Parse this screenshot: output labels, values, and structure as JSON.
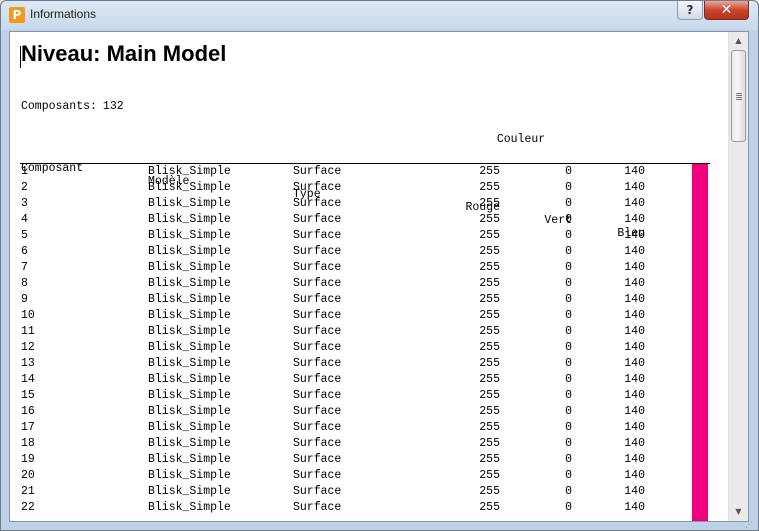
{
  "window": {
    "title": "Informations",
    "app_icon_letter": "P",
    "help_label": "?",
    "close_label": "✕"
  },
  "document": {
    "heading": "Niveau: Main Model",
    "count_label": "Composants:",
    "count_value": "132",
    "group_header": "Couleur",
    "columns": [
      "Composant",
      "Modèle",
      "Type",
      "Rouge",
      "Vert",
      "Bleu"
    ],
    "swatch_color": "#f0007f",
    "rows": [
      [
        "1",
        "Blisk_Simple",
        "Surface",
        "255",
        "0",
        "140"
      ],
      [
        "2",
        "Blisk_Simple",
        "Surface",
        "255",
        "0",
        "140"
      ],
      [
        "3",
        "Blisk_Simple",
        "Surface",
        "255",
        "0",
        "140"
      ],
      [
        "4",
        "Blisk_Simple",
        "Surface",
        "255",
        "0",
        "140"
      ],
      [
        "5",
        "Blisk_Simple",
        "Surface",
        "255",
        "0",
        "140"
      ],
      [
        "6",
        "Blisk_Simple",
        "Surface",
        "255",
        "0",
        "140"
      ],
      [
        "7",
        "Blisk_Simple",
        "Surface",
        "255",
        "0",
        "140"
      ],
      [
        "8",
        "Blisk_Simple",
        "Surface",
        "255",
        "0",
        "140"
      ],
      [
        "9",
        "Blisk_Simple",
        "Surface",
        "255",
        "0",
        "140"
      ],
      [
        "10",
        "Blisk_Simple",
        "Surface",
        "255",
        "0",
        "140"
      ],
      [
        "11",
        "Blisk_Simple",
        "Surface",
        "255",
        "0",
        "140"
      ],
      [
        "12",
        "Blisk_Simple",
        "Surface",
        "255",
        "0",
        "140"
      ],
      [
        "13",
        "Blisk_Simple",
        "Surface",
        "255",
        "0",
        "140"
      ],
      [
        "14",
        "Blisk_Simple",
        "Surface",
        "255",
        "0",
        "140"
      ],
      [
        "15",
        "Blisk_Simple",
        "Surface",
        "255",
        "0",
        "140"
      ],
      [
        "16",
        "Blisk_Simple",
        "Surface",
        "255",
        "0",
        "140"
      ],
      [
        "17",
        "Blisk_Simple",
        "Surface",
        "255",
        "0",
        "140"
      ],
      [
        "18",
        "Blisk_Simple",
        "Surface",
        "255",
        "0",
        "140"
      ],
      [
        "19",
        "Blisk_Simple",
        "Surface",
        "255",
        "0",
        "140"
      ],
      [
        "20",
        "Blisk_Simple",
        "Surface",
        "255",
        "0",
        "140"
      ],
      [
        "21",
        "Blisk_Simple",
        "Surface",
        "255",
        "0",
        "140"
      ],
      [
        "22",
        "Blisk_Simple",
        "Surface",
        "255",
        "0",
        "140"
      ]
    ]
  },
  "scrollbar": {
    "up_arrow": "▲",
    "down_arrow": "▼"
  },
  "resize_grip": "⋰"
}
